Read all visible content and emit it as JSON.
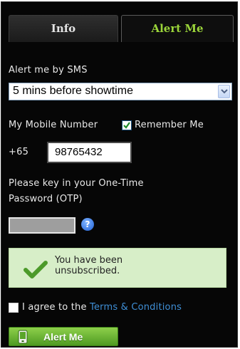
{
  "tabs": [
    {
      "label": "Info",
      "active": false
    },
    {
      "label": "Alert Me",
      "active": true
    }
  ],
  "sms": {
    "label": "Alert me by SMS",
    "selected": "5 mins before showtime"
  },
  "mobile": {
    "label": "My Mobile Number",
    "remember_label": "Remember Me",
    "remember_checked": true,
    "prefix": "+65",
    "value": "98765432"
  },
  "otp": {
    "label_line1": "Please key in your One-Time",
    "label_line2": "Password (OTP)",
    "help_glyph": "?"
  },
  "notice": {
    "line1": "You have been",
    "line2": "unsubscribed."
  },
  "terms": {
    "text": "I agree to the ",
    "link": "Terms & Conditions",
    "checked": false
  },
  "button": {
    "label": "Alert Me"
  },
  "colors": {
    "background": "#060606",
    "accent": "#9bd53a",
    "link": "#3f8fd6",
    "notice_bg": "#d7eec8",
    "button": "#6cb437"
  }
}
